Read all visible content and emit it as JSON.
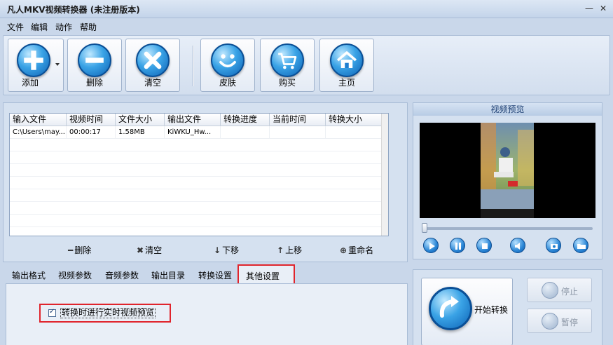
{
  "window": {
    "title": "凡人MKV视频转换器  (未注册版本)",
    "minimize_glyph": "—",
    "close_glyph": "✕"
  },
  "menu": [
    "文件",
    "编辑",
    "动作",
    "帮助"
  ],
  "toolbar": {
    "add": "添加",
    "delete": "删除",
    "clear": "清空",
    "skin": "皮肤",
    "buy": "购买",
    "home": "主页"
  },
  "file_table": {
    "columns": [
      "输入文件",
      "视频时间",
      "文件大小",
      "输出文件",
      "转换进度",
      "当前时间",
      "转换大小"
    ],
    "rows": [
      [
        "C:\\Users\\may...",
        "00:00:17",
        "1.58MB",
        "KiWKU_Hw...",
        "",
        "",
        ""
      ]
    ]
  },
  "list_actions": {
    "delete": "删除",
    "clear": "清空",
    "move_down": "下移",
    "move_up": "上移",
    "rename": "重命名"
  },
  "tabs": [
    "输出格式",
    "视频参数",
    "音频参数",
    "输出目录",
    "转换设置",
    "其他设置"
  ],
  "active_tab": "其他设置",
  "other_settings": {
    "realtime_preview_label": "转换时进行实时视频预览",
    "realtime_preview_checked": true
  },
  "preview": {
    "title": "视频预览"
  },
  "convert": {
    "start": "开始转换",
    "stop": "停止",
    "pause": "暂停"
  },
  "colors": {
    "highlight_red": "#e0242c",
    "button_blue": "#1f7fd0",
    "panel_bg": "#d5e1f0"
  }
}
